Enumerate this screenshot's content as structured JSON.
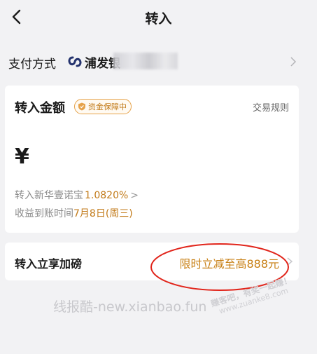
{
  "header": {
    "title": "转入",
    "back_icon": "back-chevron-icon"
  },
  "payment": {
    "label": "支付方式",
    "bank_name": "浦发银",
    "bank_icon": "spdb-logo-icon",
    "chevron_icon": "chevron-right-icon"
  },
  "amount_card": {
    "title": "转入金额",
    "badge": "资金保障中",
    "rules_link": "交易规则",
    "currency_symbol": "¥",
    "product_prefix": "转入新华壹诺宝",
    "rate": "1.0820%",
    "rate_chevron": ">",
    "arrival_prefix": "收益到账时间",
    "arrival_date": "7月8日(周三)"
  },
  "promo": {
    "label": "转入立享加磅",
    "value": "限时立减至高888元"
  },
  "watermark": {
    "text": "线报酷-new.xianbao.fun",
    "stamp_line1": "赚客吧，有奖一起赚！",
    "stamp_line2": "www.zuanke8.com"
  },
  "colors": {
    "background": "#f2f2f4",
    "accent": "#c27a18",
    "annotation": "#e1251b"
  }
}
